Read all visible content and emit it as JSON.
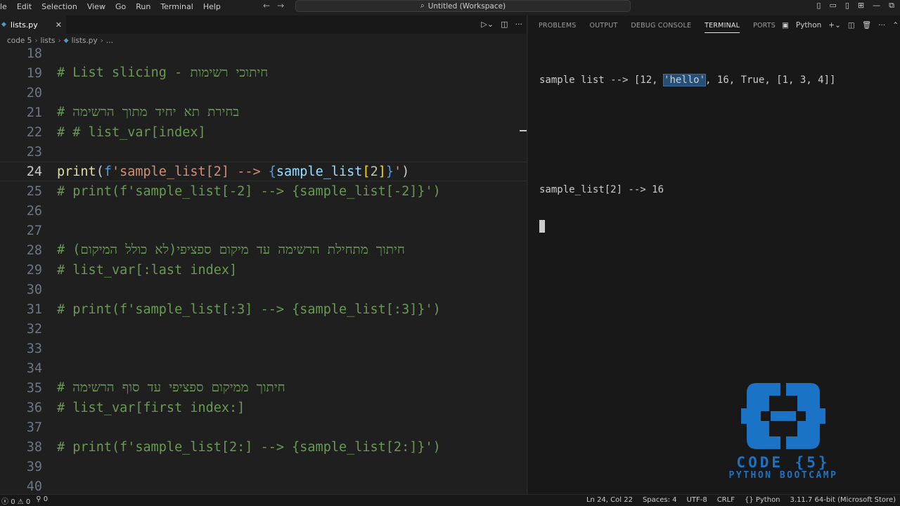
{
  "menu": [
    "le",
    "Edit",
    "Selection",
    "View",
    "Go",
    "Run",
    "Terminal",
    "Help"
  ],
  "search": {
    "label": "Untitled (Workspace)"
  },
  "editor": {
    "tab_label": "lists.py",
    "breadcrumb": [
      "code 5",
      "lists",
      "lists.py",
      "..."
    ]
  },
  "code_lines": [
    {
      "num": "18",
      "text": ""
    },
    {
      "num": "19",
      "text": "# List slicing - חיתוכי רשימות"
    },
    {
      "num": "20",
      "text": ""
    },
    {
      "num": "21",
      "text": "# בחירת תא יחיד מתוך הרשימה"
    },
    {
      "num": "22",
      "text": "# # list_var[index]"
    },
    {
      "num": "23",
      "text": ""
    },
    {
      "num": "24",
      "text": "print(f'sample_list[2] --> {sample_list[2]}')"
    },
    {
      "num": "25",
      "text": "# print(f'sample_list[-2] --> {sample_list[-2]}')"
    },
    {
      "num": "26",
      "text": ""
    },
    {
      "num": "27",
      "text": ""
    },
    {
      "num": "28",
      "text": "# חיתוך מתחילת הרשימה עד מיקום ספציפי(לא כולל המיקום)"
    },
    {
      "num": "29",
      "text": "# list_var[:last index]"
    },
    {
      "num": "30",
      "text": ""
    },
    {
      "num": "31",
      "text": "# print(f'sample_list[:3] --> {sample_list[:3]}')"
    },
    {
      "num": "32",
      "text": ""
    },
    {
      "num": "33",
      "text": ""
    },
    {
      "num": "34",
      "text": ""
    },
    {
      "num": "35",
      "text": "# חיתוך ממיקום ספציפי עד סוף הרשימה"
    },
    {
      "num": "36",
      "text": "# list_var[first index:]"
    },
    {
      "num": "37",
      "text": ""
    },
    {
      "num": "38",
      "text": "# print(f'sample_list[2:] --> {sample_list[2:]}')"
    },
    {
      "num": "39",
      "text": ""
    },
    {
      "num": "40",
      "text": ""
    }
  ],
  "panel": {
    "tabs": [
      "PROBLEMS",
      "OUTPUT",
      "DEBUG CONSOLE",
      "TERMINAL",
      "PORTS"
    ],
    "active_tab": "TERMINAL",
    "shell_label": "Python"
  },
  "terminal": {
    "line1_prefix": "sample list --> [12, ",
    "line1_selected": "'hello'",
    "line1_suffix": ", 16, True, [1, 3, 4]]",
    "line2": "sample_list[2] --> 16"
  },
  "logo": {
    "line1": "CODE {5}",
    "line2": "PYTHON BOOTCAMP",
    "color": "#1a73c5"
  },
  "status": {
    "errors": "0",
    "warnings": "0",
    "ports": "0",
    "position": "Ln 24, Col 22",
    "spaces": "Spaces: 4",
    "encoding": "UTF-8",
    "eol": "CRLF",
    "language": "Python",
    "interpreter": "3.11.7 64-bit (Microsoft Store)"
  }
}
